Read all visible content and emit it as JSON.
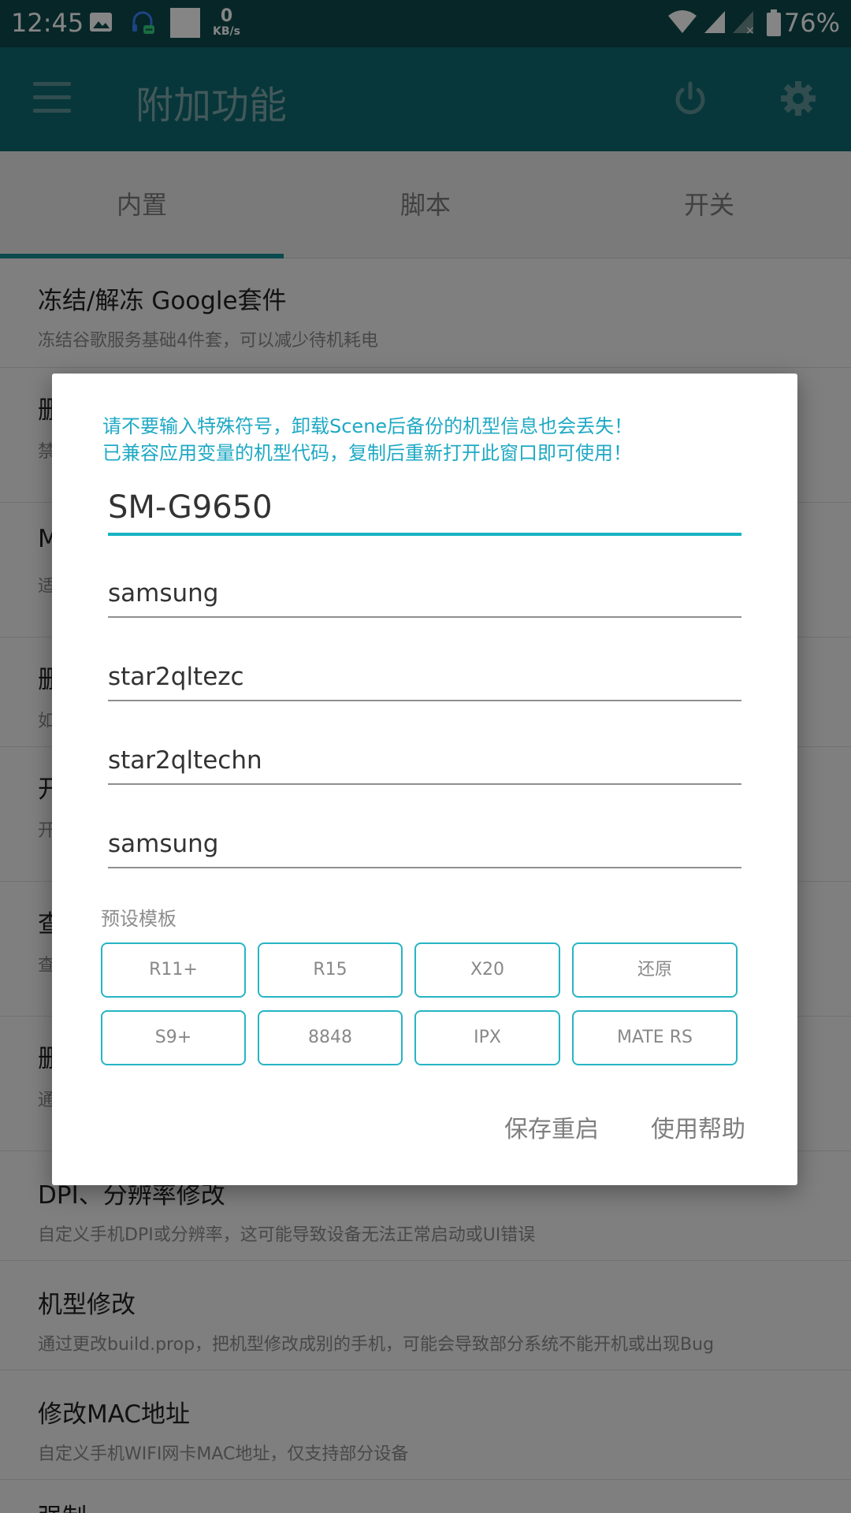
{
  "status_bar": {
    "time": "12:45",
    "speed_value": "0",
    "speed_unit": "KB/s",
    "battery": "76%",
    "icons": [
      "image-icon",
      "headset-chat-icon",
      "white-square-icon",
      "wifi-icon",
      "signal-icon",
      "signal-off-icon",
      "battery-icon"
    ]
  },
  "app_bar": {
    "title": "附加功能",
    "icons": [
      "menu-icon",
      "power-icon",
      "gear-icon"
    ]
  },
  "tabs": [
    {
      "label": "内置",
      "active": true
    },
    {
      "label": "脚本",
      "active": false
    },
    {
      "label": "开关",
      "active": false
    }
  ],
  "list": [
    {
      "title": "冻结/解冻 Google套件",
      "desc": "冻结谷歌服务基础4件套，可以减少待机耗电"
    },
    {
      "title": "删",
      "desc": "禁"
    },
    {
      "title": "M",
      "desc": "适"
    },
    {
      "title": "删",
      "desc": "如"
    },
    {
      "title": "开",
      "desc": "开"
    },
    {
      "title": "查",
      "desc": "查"
    },
    {
      "title": "删",
      "desc": "通"
    },
    {
      "title": "DPI、分辨率修改",
      "desc": "自定义手机DPI或分辨率，这可能导致设备无法正常启动或UI错误"
    },
    {
      "title": "机型修改",
      "desc": "通过更改build.prop，把机型修改成别的手机，可能会导致部分系统不能开机或出现Bug"
    },
    {
      "title": "修改MAC地址",
      "desc": "自定义手机WIFI网卡MAC地址，仅支持部分设备"
    },
    {
      "title": "强制 ...",
      "desc": ""
    }
  ],
  "dialog": {
    "note_line1": "请不要输入特殊符号，卸载Scene后备份的机型信息也会丢失！",
    "note_line2": "已兼容应用变量的机型代码，复制后重新打开此窗口即可使用！",
    "fields": [
      {
        "value": "SM-G9650",
        "active": true
      },
      {
        "value": "samsung",
        "active": false
      },
      {
        "value": "star2qltezc",
        "active": false
      },
      {
        "value": "star2qltechn",
        "active": false
      },
      {
        "value": "samsung",
        "active": false
      }
    ],
    "preset_label": "预设模板",
    "presets_row1": [
      "R11+",
      "R15",
      "X20",
      "还原"
    ],
    "presets_row2": [
      "S9+",
      "8848",
      "IPX",
      "MATE RS"
    ],
    "action_save": "保存重启",
    "action_help": "使用帮助"
  },
  "colors": {
    "status_bar": "#0e4a4e",
    "app_bar": "#0e6a70",
    "accent": "#17b3c2",
    "note_text": "#1fa9c4"
  }
}
